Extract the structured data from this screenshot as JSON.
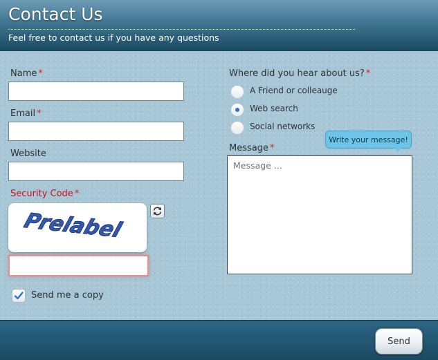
{
  "header": {
    "title": "Contact Us",
    "subtitle": "Feel free to contact us if you have any questions"
  },
  "form": {
    "name_label": "Name",
    "email_label": "Email",
    "website_label": "Website",
    "security_label": "Security Code",
    "required_mark": "*",
    "captcha_text": "Prelabel",
    "send_copy_label": "Send me a copy",
    "send_copy_checked": true,
    "hear_about_label": "Where did you hear about us?",
    "hear_options": [
      {
        "label": "A Friend or colleauge",
        "selected": false
      },
      {
        "label": "Web search",
        "selected": true
      },
      {
        "label": "Social networks",
        "selected": false
      }
    ],
    "message_label": "Message",
    "message_placeholder": "Message ...",
    "tooltip": "Write your message!"
  },
  "footer": {
    "send_label": "Send"
  },
  "colors": {
    "header_dark": "#1c4b63",
    "required_red": "#e01d24",
    "tooltip_blue": "#6cc5e9",
    "check_blue": "#2e6fd8"
  }
}
